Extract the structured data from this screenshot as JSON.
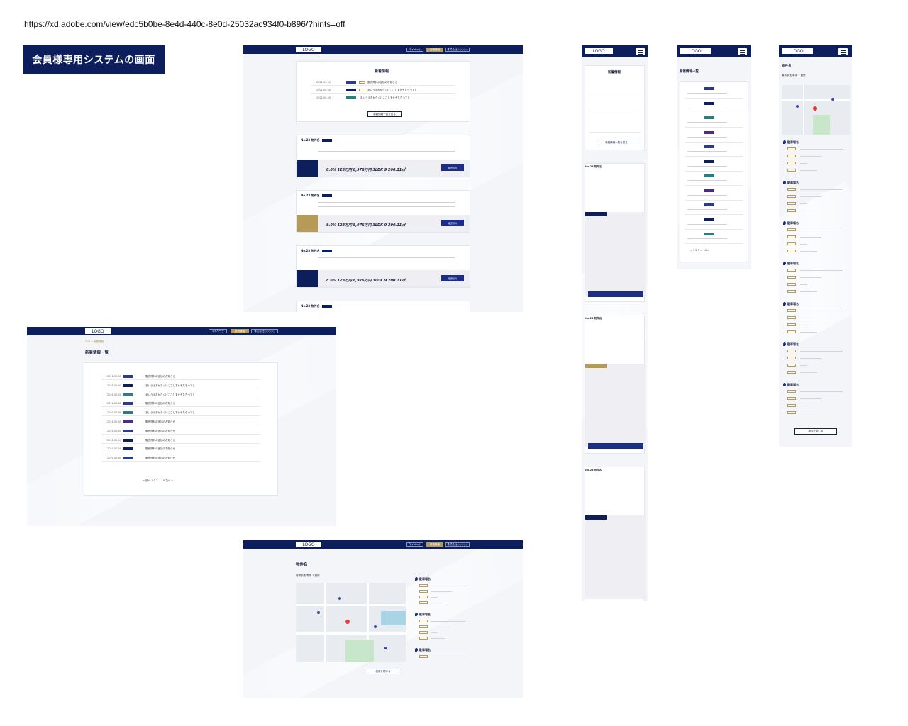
{
  "url": "https://xd.adobe.com/view/edc5b0be-8e4d-440c-8e0d-25032ac934f0-b896/?hints=off",
  "title_badge": "会員様専用システムの画面",
  "common": {
    "logo": "LOGO",
    "nav": [
      "マイページ",
      "新着情報",
      "株式会社○○○○○"
    ],
    "more_news": "新着情報一覧を見る",
    "detail_btn": "販売資料",
    "back_btn": "検索を閉じる"
  },
  "board1": {
    "news_heading": "新着情報",
    "news": [
      {
        "date": "2021.00.00",
        "text": "販売資料の追加のお知らせ"
      },
      {
        "date": "2021.00.00",
        "text": "あいうえおかきくけこさしすせそたちつてと"
      },
      {
        "date": "2021.00.00",
        "text": "あいうえおかきくけこさしすせそたちつてと"
      }
    ],
    "property_name": "No.23 物件名",
    "props": [
      {
        "nums": "8.0% 123万円 8,976万円 3LDK 9 200.11㎡"
      },
      {
        "nums": "8.0% 123万円 8,976万円 3LDK 9 200.11㎡"
      },
      {
        "nums": "8.0% 123万円 8,976万円 3LDK 9 200.11㎡"
      }
    ],
    "last_prop": "No.23 物件名"
  },
  "board2": {
    "breadcrumb": "TOP > 新着情報",
    "heading": "新着情報一覧",
    "rows": [
      {
        "date": "2021.00.00",
        "text": "販売資料の追加のお知らせ",
        "tag": "t1"
      },
      {
        "date": "2021.00.00",
        "text": "あいうえおかきくけこさしすせそたちつてと",
        "tag": "t2"
      },
      {
        "date": "2021.00.00",
        "text": "あいうえおかきくけこさしすせそたちつてと",
        "tag": "t3"
      },
      {
        "date": "2021.00.00",
        "text": "販売資料の追加のお知らせ",
        "tag": "t1"
      },
      {
        "date": "2021.00.00",
        "text": "あいうえおかきくけこさしすせそたちつてと",
        "tag": "t3"
      },
      {
        "date": "2021.00.00",
        "text": "販売資料の追加のお知らせ",
        "tag": "t4"
      },
      {
        "date": "2021.00.00",
        "text": "販売資料の追加のお知らせ",
        "tag": "t1"
      },
      {
        "date": "2021.00.00",
        "text": "販売資料の追加のお知らせ",
        "tag": "t2"
      },
      {
        "date": "2021.00.00",
        "text": "販売資料の追加のお知らせ",
        "tag": "t2"
      },
      {
        "date": "2021.00.00",
        "text": "販売資料の追加のお知らせ",
        "tag": "t1"
      }
    ],
    "pager": "< 前へ   1  2  3  ...  10   次へ >"
  },
  "board3": {
    "heading": "物件名",
    "subheading": "最寄駅 駐車場  7 箇所",
    "list_item": "駐車場名"
  },
  "mobile": {
    "news_heading": "新着情報",
    "news_list_heading": "新着情報一覧",
    "map_heading": "物件名",
    "map_sub": "最寄駅 駐車場  7 箇所",
    "pager": "< 1 2 3 ... 10 >",
    "prop_name": "No.23 物件名",
    "list_item": "駐車場名"
  }
}
